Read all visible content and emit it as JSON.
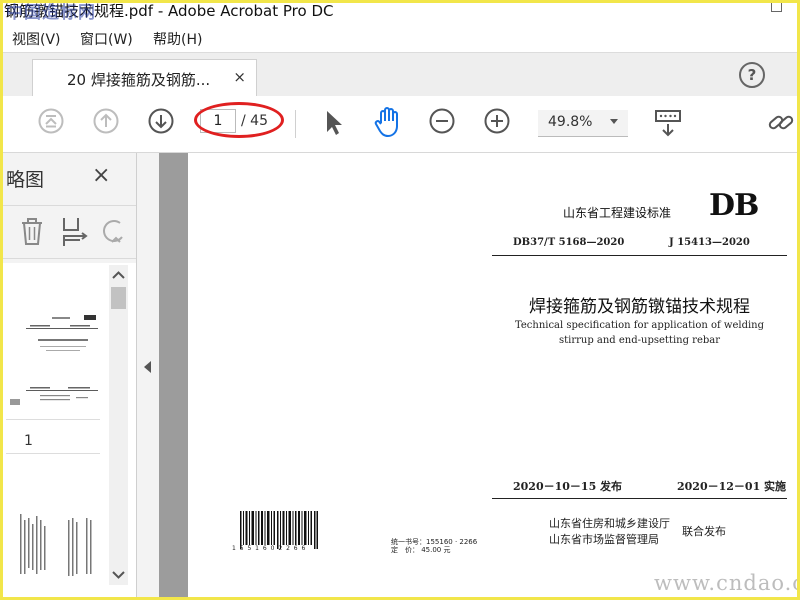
{
  "window": {
    "title": "钢筋镦锚技术规程.pdf - Adobe Acrobat Pro DC",
    "title_overlay": "中国造标网"
  },
  "menu": [
    "视图(V)",
    "窗口(W)",
    "帮助(H)"
  ],
  "tab": {
    "label": "20 焊接箍筋及钢筋...",
    "close": "×"
  },
  "help": "?",
  "toolbar": {
    "page_current": "1",
    "page_total": "/ 45",
    "zoom": "49.8%"
  },
  "panel": {
    "title": "略图",
    "close": "×",
    "thumb_page_number": "1"
  },
  "document": {
    "standard_type": "山东省工程建设标准",
    "db_logo": "DB",
    "code": "DB37/T 5168—2020",
    "record_code": "J 15413—2020",
    "title_cn": "焊接箍筋及钢筋镦锚技术规程",
    "title_en_line1": "Technical specification for application of welding",
    "title_en_line2": "stirrup and end-upsetting rebar",
    "issue_date": "2020－10－15 发布",
    "implement_date": "2020－12－01 实施",
    "publisher1": "山东省住房和城乡建设厅",
    "publisher2": "山东省市场监督管理局",
    "joint_issue": "联合发布",
    "isbn_digits": "1 5 5 1 6 0 2 2 6 6",
    "book_number": "统一书号：155160 · 2266",
    "price": "定　价：  45.00  元"
  },
  "watermark": "www.cndao.com",
  "colors": {
    "accent_blue": "#1473e6",
    "highlight_red": "#e02020",
    "frame_yellow": "#f2e64a"
  }
}
